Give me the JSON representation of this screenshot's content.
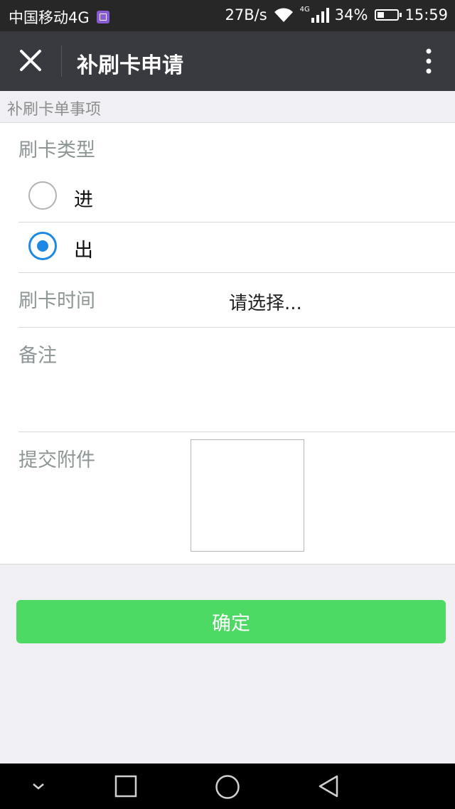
{
  "status_bar": {
    "carrier": "中国移动4G",
    "icons": [
      "gallery-icon",
      "wifi-icon",
      "signal-icon",
      "battery-icon"
    ],
    "speed": "27B/s",
    "network_type": "4G",
    "battery": "34%",
    "time": "15:59"
  },
  "nav": {
    "title": "补刷卡申请",
    "close_icon": "close-icon",
    "more_icon": "more-vertical-icon"
  },
  "section": {
    "title": "补刷卡单事项"
  },
  "form": {
    "type_label": "刷卡类型",
    "options": [
      {
        "label": "进",
        "checked": false
      },
      {
        "label": "出",
        "checked": true
      }
    ],
    "time_label": "刷卡时间",
    "time_placeholder": "请选择...",
    "remark_label": "备注",
    "attachment_label": "提交附件"
  },
  "confirm_label": "确定",
  "colors": {
    "accent_blue": "#1e88e5",
    "confirm_green": "#4cd964",
    "nav_bg": "#393a3f",
    "label_gray": "#8d9595"
  },
  "android_nav": {
    "icons": [
      "chevron-down-icon",
      "recents-square-icon",
      "home-circle-icon",
      "back-triangle-icon"
    ]
  }
}
